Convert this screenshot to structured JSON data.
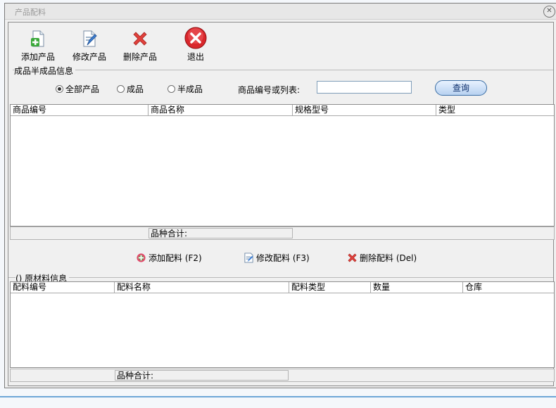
{
  "window": {
    "title": "产品配料",
    "close_icon": "close-icon"
  },
  "toolbar": {
    "add_label": "添加产品",
    "edit_label": "修改产品",
    "delete_label": "删除产品",
    "exit_label": "退出"
  },
  "product_group": {
    "title": "成品半成品信息"
  },
  "filter": {
    "all_label": "全部产品",
    "finished_label": "成品",
    "semi_label": "半成品",
    "selected": "全部产品",
    "search_label": "商品编号或列表:",
    "search_value": "",
    "query_label": "查询"
  },
  "product_table": {
    "columns": [
      "商品编号",
      "商品名称",
      "规格型号",
      "类型"
    ],
    "rows": []
  },
  "product_summary": {
    "label": "品种合计:"
  },
  "ingredient_actions": {
    "add_label": "添加配料 (F2)",
    "edit_label": "修改配料 (F3)",
    "delete_label": "删除配料 (Del)"
  },
  "material_group": {
    "title": "() 原材料信息"
  },
  "material_table": {
    "columns": [
      "配料编号",
      "配料名称",
      "配料类型",
      "数量",
      "仓库"
    ],
    "rows": []
  },
  "material_summary": {
    "label": "品种合计:"
  },
  "colors": {
    "accent": "#3b6ea5",
    "window_bg": "#f0f0f0",
    "danger": "#d9262b"
  }
}
